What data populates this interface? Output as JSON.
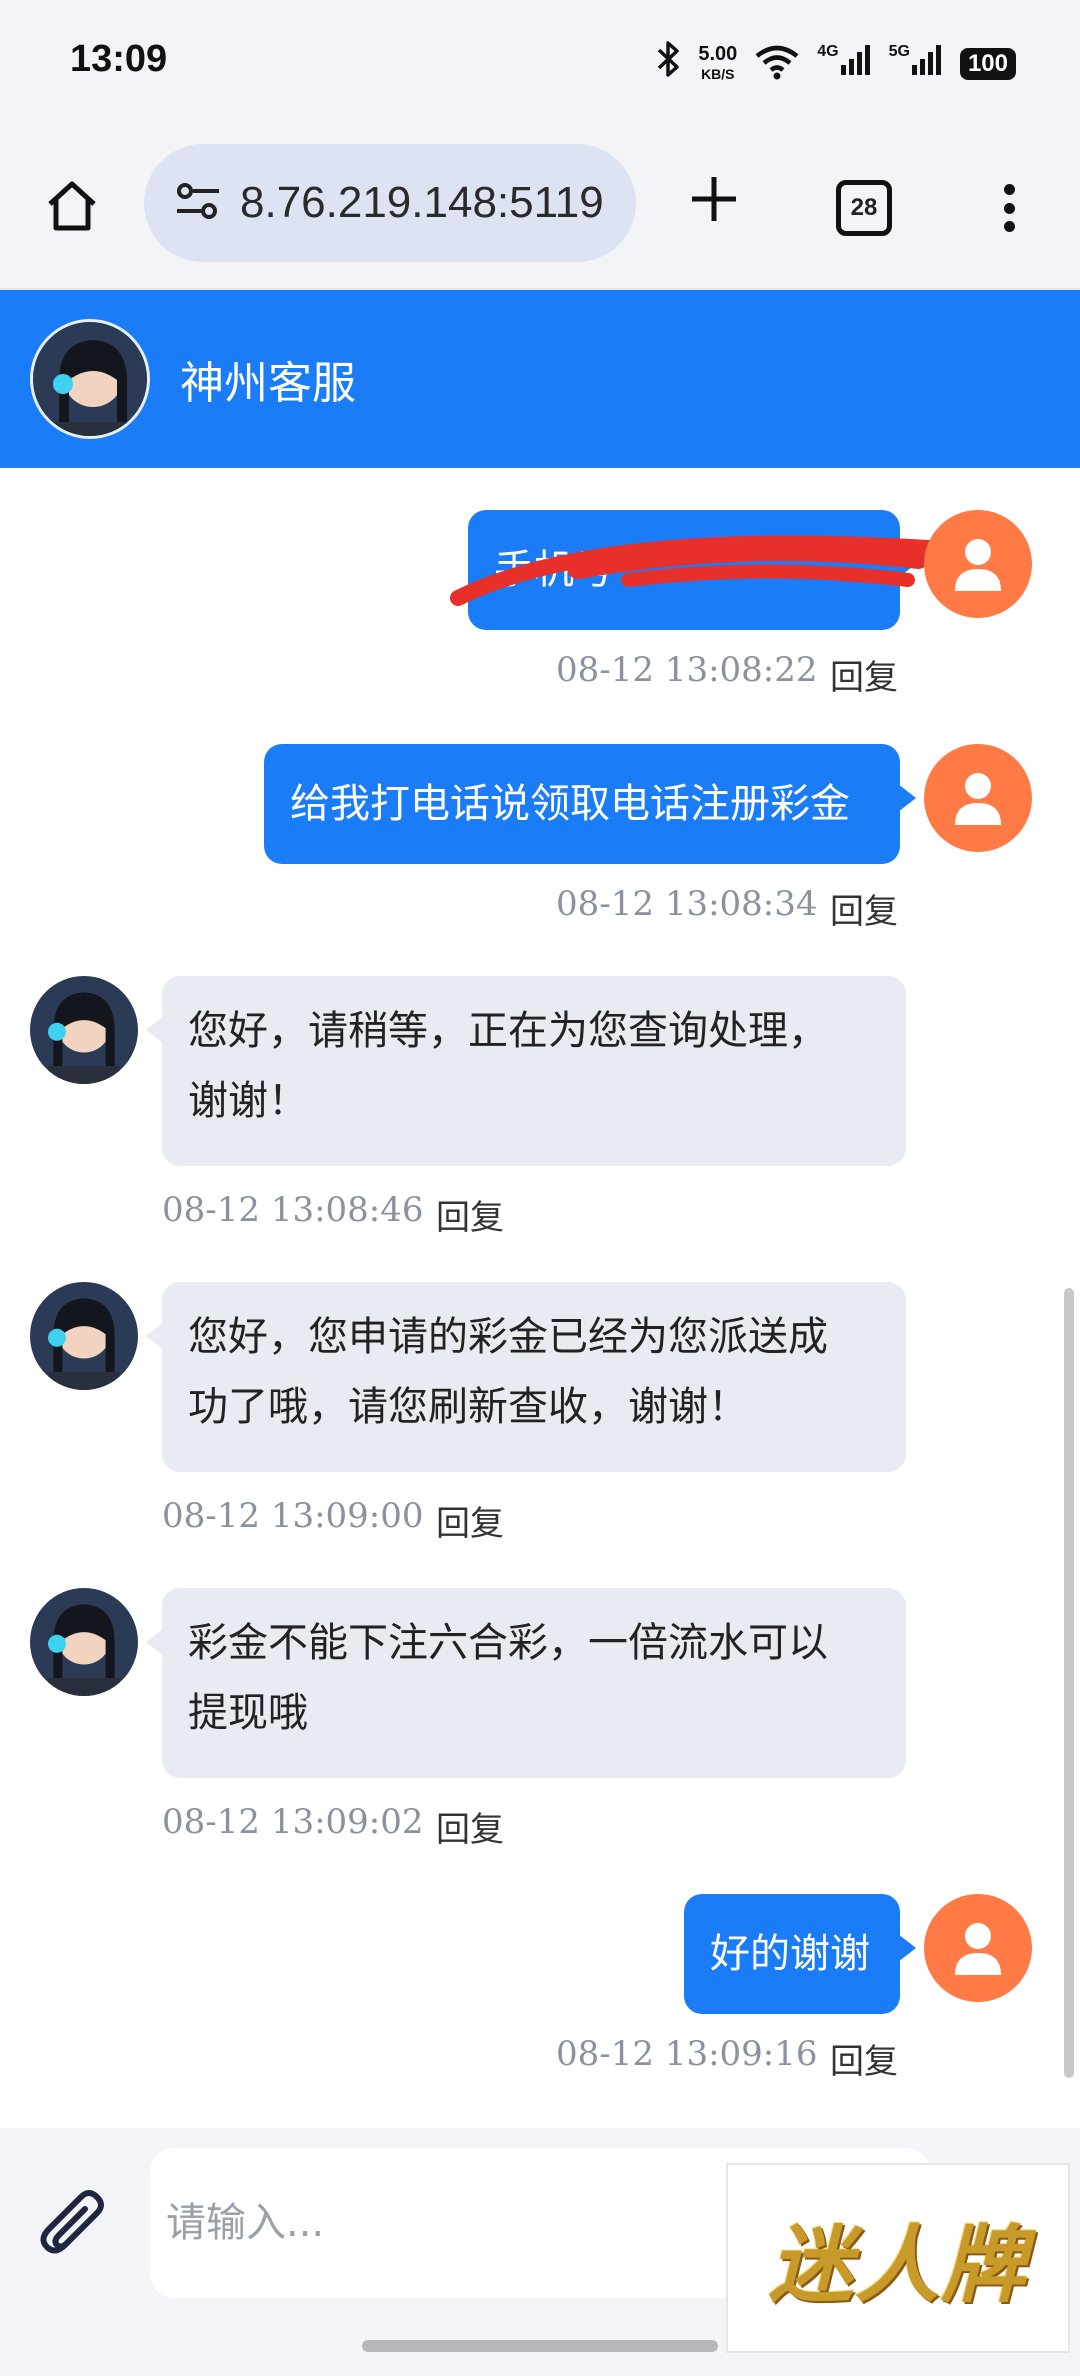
{
  "status_bar": {
    "time": "13:09",
    "net_speed_value": "5.00",
    "net_speed_unit": "KB/S",
    "signal_4g": "4G",
    "signal_5g": "5G",
    "battery": "100"
  },
  "browser": {
    "url": "8.76.219.148:5119",
    "tab_count": "28",
    "icons": [
      "home-icon",
      "tune-icon",
      "plus-icon",
      "tabs-icon",
      "more-vert-icon"
    ]
  },
  "chat": {
    "header_title": "神州客服",
    "reply_label": "回复",
    "messages": [
      {
        "side": "out",
        "text": "手机号",
        "time": "08-12 13:08:22",
        "redacted": true
      },
      {
        "side": "out",
        "text": "给我打电话说领取电话注册彩金",
        "time": "08-12 13:08:34"
      },
      {
        "side": "in",
        "line1": "您好，请稍等，正在为您查询处理，",
        "line2": "谢谢！",
        "time": "08-12 13:08:46"
      },
      {
        "side": "in",
        "line1": "您好，您申请的彩金已经为您派送成",
        "line2": "功了哦，请您刷新查收，谢谢！",
        "time": "08-12 13:09:00"
      },
      {
        "side": "in",
        "line1": "彩金不能下注六合彩，一倍流水可以",
        "line2": "提现哦",
        "time": "08-12 13:09:02"
      },
      {
        "side": "out",
        "text": "好的谢谢",
        "time": "08-12 13:09:16"
      }
    ]
  },
  "input": {
    "placeholder": "请输入...",
    "value": ""
  },
  "watermark": {
    "text": "迷人牌"
  },
  "colors": {
    "primary": "#1a7cf7",
    "user_avatar": "#ff7a45",
    "incoming_bubble": "#e8ebf1"
  }
}
